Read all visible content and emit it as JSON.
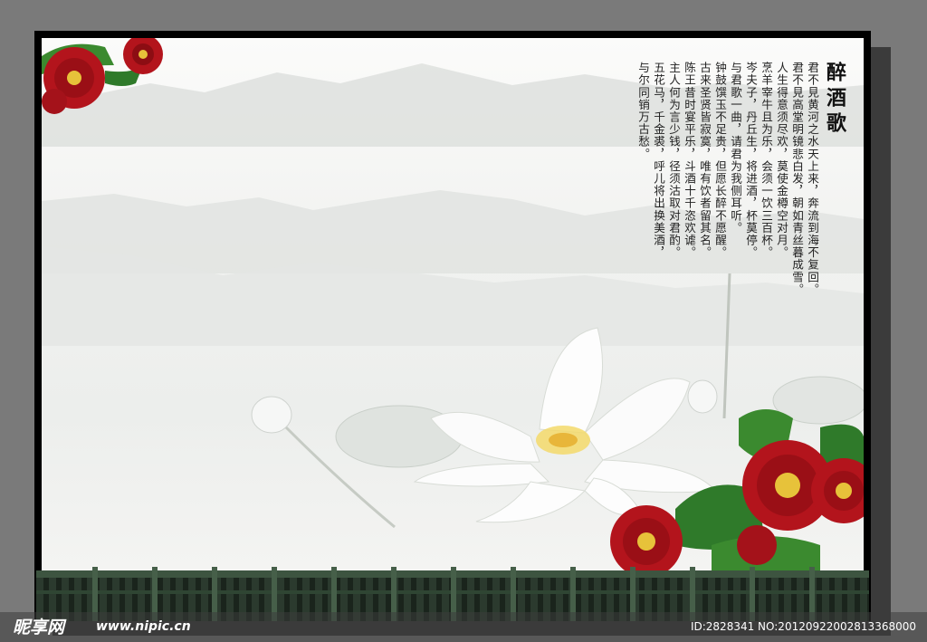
{
  "poem": {
    "title": "醉酒歌",
    "lines": [
      "君不見黄河之水天上来，奔流到海不复回。",
      "君不見高堂明镜悲白发，朝如青丝暮成雪。",
      "人生得意须尽欢，莫使金樽空对月。",
      "烹羊宰牛且为乐，会须一饮三百杯。",
      "岑夫子，丹丘生，将进酒，杯莫停。",
      "与君歌一曲，请君为我侧耳听。",
      "钟鼓馔玉不足贵，但愿长醉不愿醒。",
      "古来圣贤皆寂寞，唯有饮者留其名。",
      "陈王昔时宴平乐，斗酒十千恣欢谑。",
      "主人何为言少钱，径须沽取对君酌。",
      "五花马，千金裘，呼儿将出换美酒，",
      "与尔同销万古愁。"
    ]
  },
  "watermark": {
    "logo": "昵享网",
    "url": "www.nipic.cn",
    "id": "ID:2828341 NO:20120922002813368000"
  },
  "colors": {
    "peony": "#b3141c",
    "leaf": "#2f7a2a",
    "background": "#f1f2f0",
    "fence": "#2b3a2e"
  }
}
